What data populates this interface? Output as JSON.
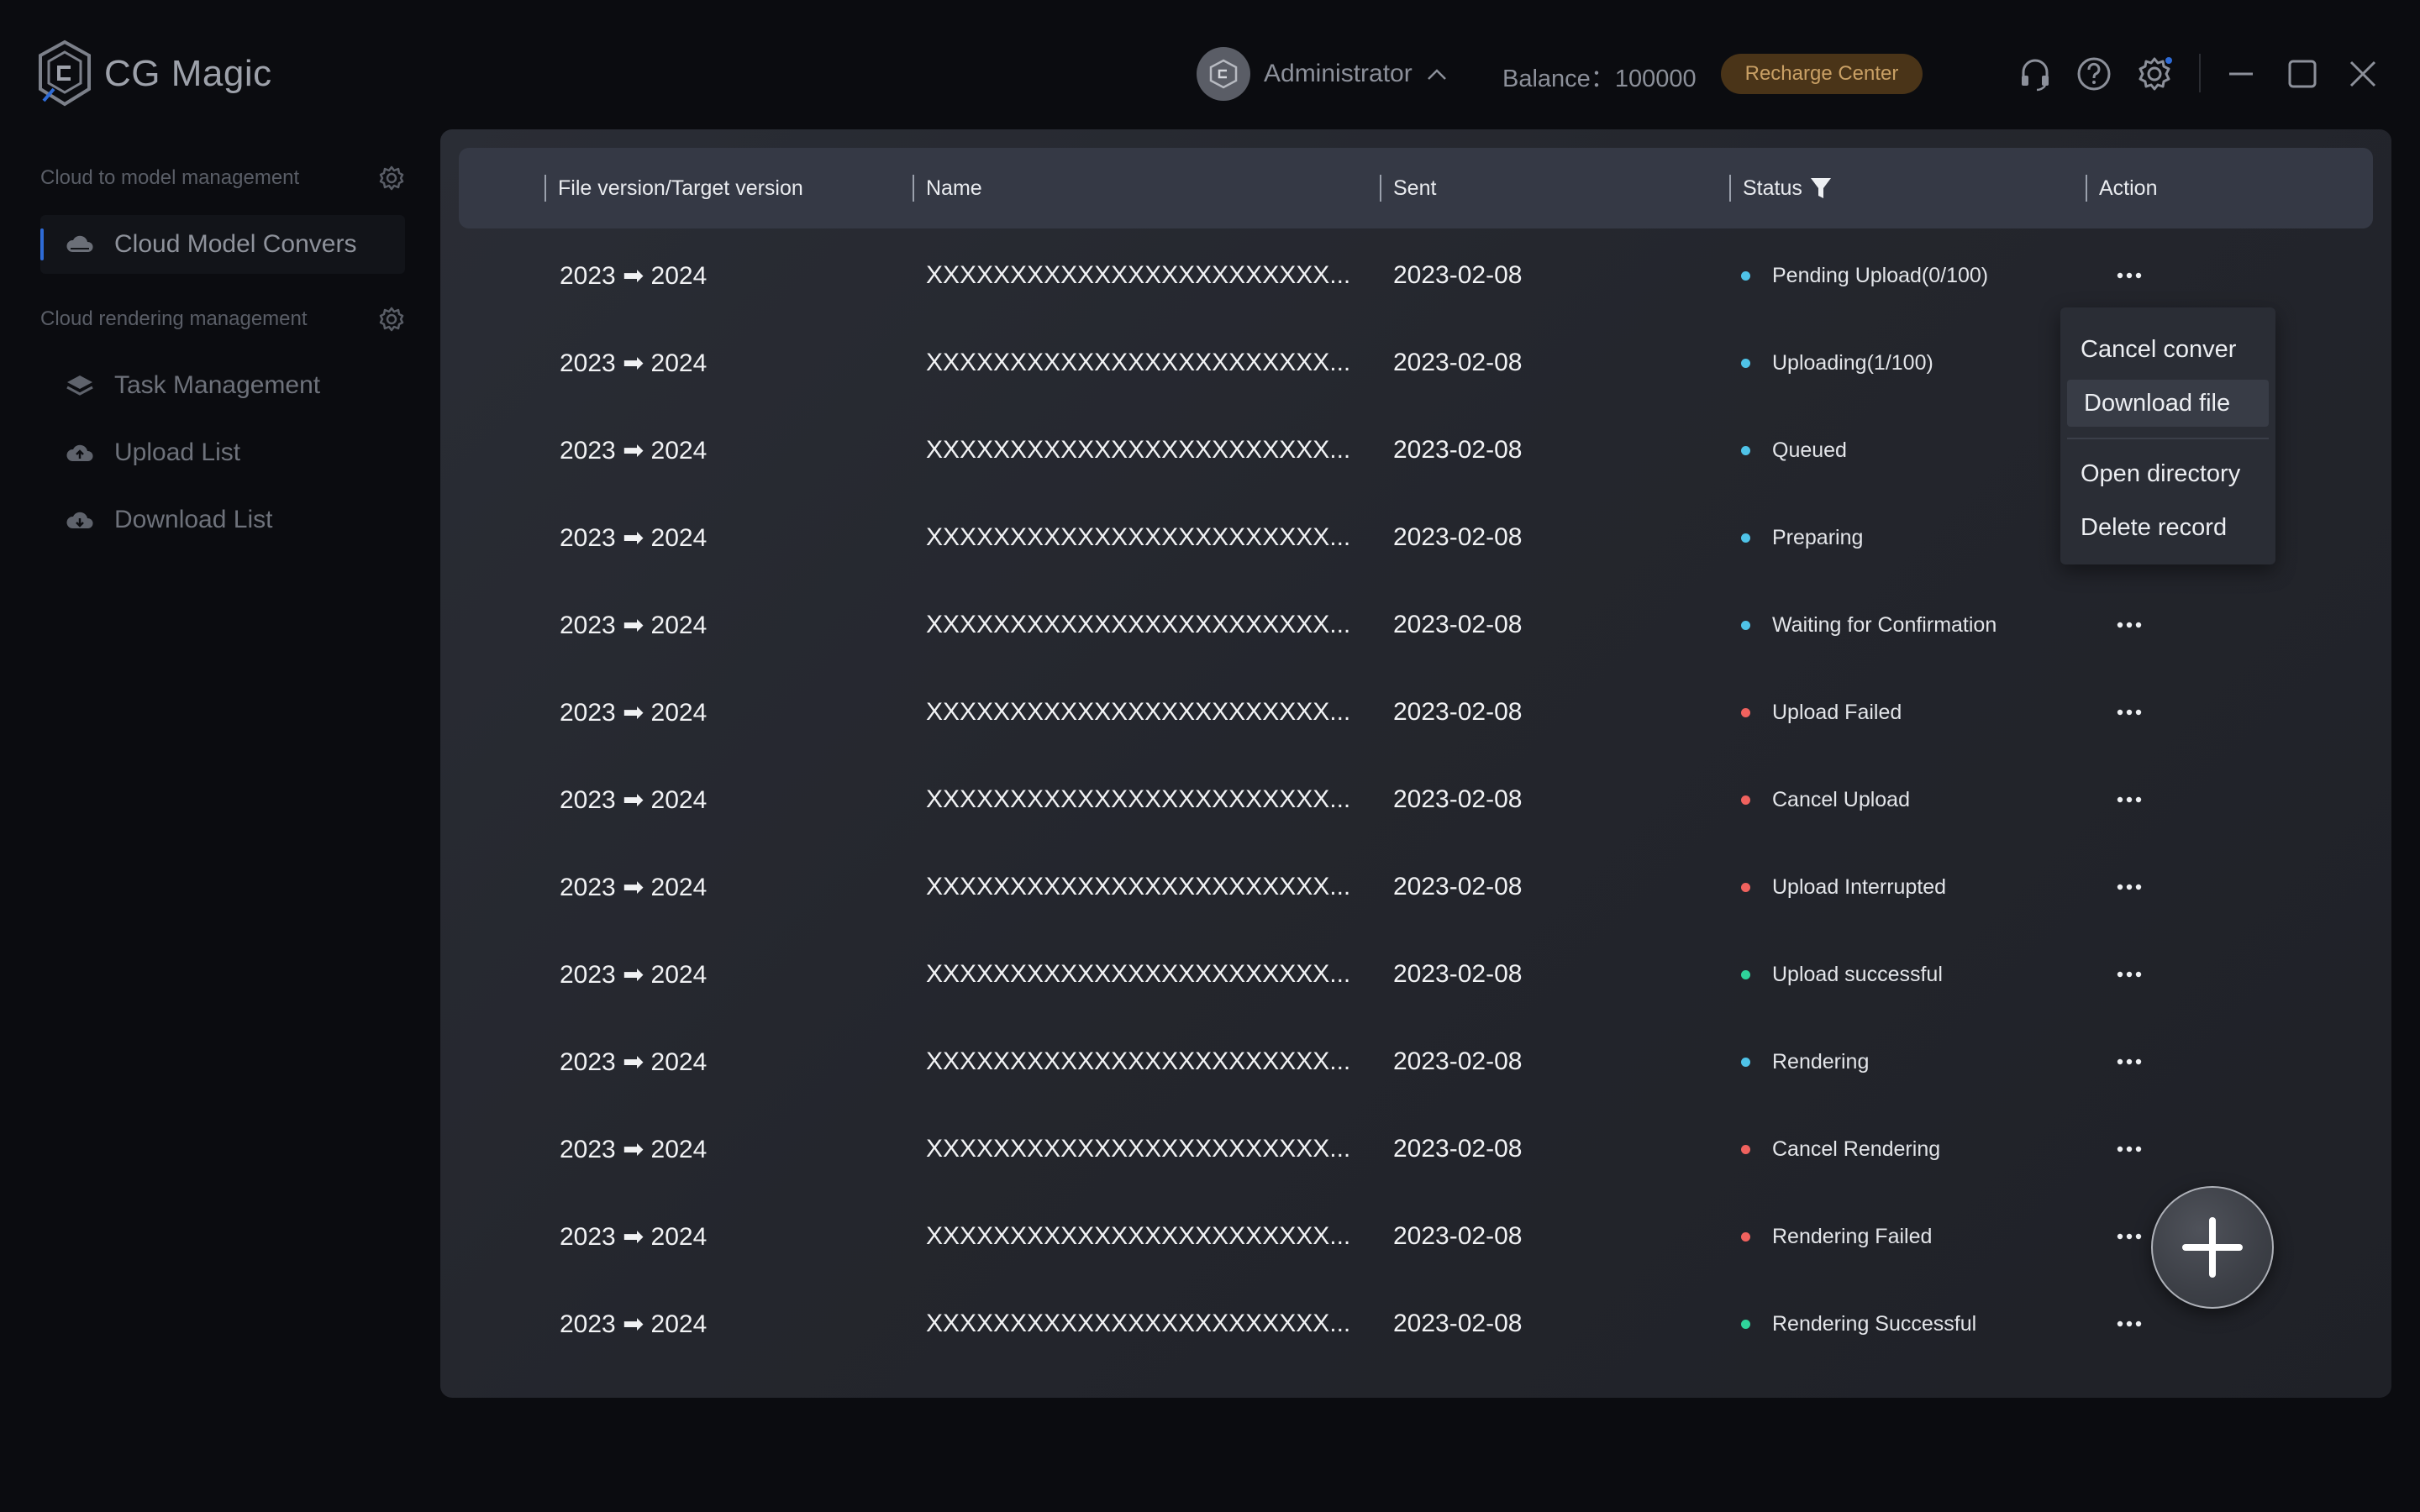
{
  "app": {
    "name": "CG Magic"
  },
  "header": {
    "user_name": "Administrator",
    "balance_label": "Balance：",
    "balance_value": "100000",
    "recharge_label": "Recharge Center"
  },
  "sidebar": {
    "sections": [
      {
        "title": "Cloud to model management",
        "items": [
          {
            "label": "Cloud Model Convers",
            "icon": "cloud-icon",
            "active": true
          }
        ]
      },
      {
        "title": "Cloud rendering management",
        "items": [
          {
            "label": "Task Management",
            "icon": "layers-icon",
            "active": false
          },
          {
            "label": "Upload List",
            "icon": "cloud-upload-icon",
            "active": false
          },
          {
            "label": "Download List",
            "icon": "cloud-download-icon",
            "active": false
          }
        ]
      }
    ]
  },
  "table": {
    "columns": [
      "File version/Target version",
      "Name",
      "Sent",
      "Status",
      "Action"
    ],
    "rows": [
      {
        "version": "2023 ➡ 2024",
        "name": "XXXXXXXXXXXXXXXXXXXXXXXX...",
        "sent": "2023-02-08",
        "status": "Pending Upload(0/100)",
        "status_color": "#4fc3e8"
      },
      {
        "version": "2023 ➡ 2024",
        "name": "XXXXXXXXXXXXXXXXXXXXXXXX...",
        "sent": "2023-02-08",
        "status": "Uploading(1/100)",
        "status_color": "#4fc3e8"
      },
      {
        "version": "2023 ➡ 2024",
        "name": "XXXXXXXXXXXXXXXXXXXXXXXX...",
        "sent": "2023-02-08",
        "status": "Queued",
        "status_color": "#4fc3e8"
      },
      {
        "version": "2023 ➡ 2024",
        "name": "XXXXXXXXXXXXXXXXXXXXXXXX...",
        "sent": "2023-02-08",
        "status": "Preparing",
        "status_color": "#4fc3e8"
      },
      {
        "version": "2023 ➡ 2024",
        "name": "XXXXXXXXXXXXXXXXXXXXXXXX...",
        "sent": "2023-02-08",
        "status": "Waiting for Confirmation",
        "status_color": "#4fc3e8"
      },
      {
        "version": "2023 ➡ 2024",
        "name": "XXXXXXXXXXXXXXXXXXXXXXXX...",
        "sent": "2023-02-08",
        "status": "Upload Failed",
        "status_color": "#f0625e"
      },
      {
        "version": "2023 ➡ 2024",
        "name": "XXXXXXXXXXXXXXXXXXXXXXXX...",
        "sent": "2023-02-08",
        "status": "Cancel Upload",
        "status_color": "#f0625e"
      },
      {
        "version": "2023 ➡ 2024",
        "name": "XXXXXXXXXXXXXXXXXXXXXXXX...",
        "sent": "2023-02-08",
        "status": "Upload Interrupted",
        "status_color": "#f0625e"
      },
      {
        "version": "2023 ➡ 2024",
        "name": "XXXXXXXXXXXXXXXXXXXXXXXX...",
        "sent": "2023-02-08",
        "status": "Upload successful",
        "status_color": "#2fd39a"
      },
      {
        "version": "2023 ➡ 2024",
        "name": "XXXXXXXXXXXXXXXXXXXXXXXX...",
        "sent": "2023-02-08",
        "status": "Rendering",
        "status_color": "#4fc3e8"
      },
      {
        "version": "2023 ➡ 2024",
        "name": "XXXXXXXXXXXXXXXXXXXXXXXX...",
        "sent": "2023-02-08",
        "status": "Cancel Rendering",
        "status_color": "#f0625e"
      },
      {
        "version": "2023 ➡ 2024",
        "name": "XXXXXXXXXXXXXXXXXXXXXXXX...",
        "sent": "2023-02-08",
        "status": "Rendering Failed",
        "status_color": "#f0625e"
      },
      {
        "version": "2023 ➡ 2024",
        "name": "XXXXXXXXXXXXXXXXXXXXXXXX...",
        "sent": "2023-02-08",
        "status": "Rendering Successful",
        "status_color": "#2fd39a"
      }
    ]
  },
  "context_menu": {
    "items": [
      "Cancel conver",
      "Download file",
      "Open directory",
      "Delete record"
    ],
    "hovered": "Download file"
  },
  "colors": {
    "accent": "#2e6bd6",
    "recharge_bg": "#4a3418",
    "recharge_text": "#c9a065",
    "status_blue": "#4fc3e8",
    "status_red": "#f0625e",
    "status_green": "#2fd39a"
  }
}
